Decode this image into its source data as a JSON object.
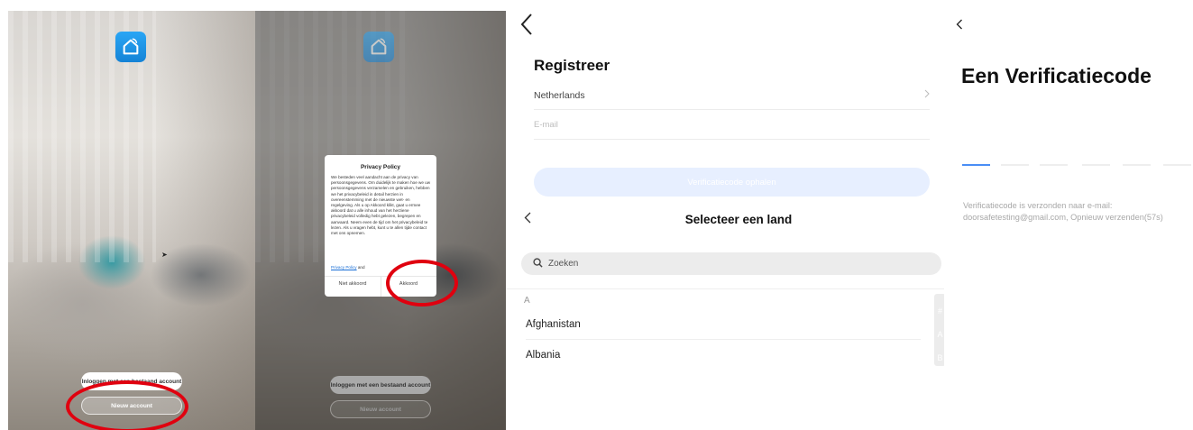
{
  "panel1": {
    "login_button": "Inloggen met een bestaand account",
    "new_account_button": "Nieuw account"
  },
  "panel2": {
    "dialog": {
      "title": "Privacy Policy",
      "body": "We besteden veel aandacht aan de privacy van persoonsgegevens. Om duidelijk te maken hoe we uw persoonsgegevens verzamelen en gebruiken, hebben we het privacybeleid in detail herzien in overeenstemming met de nieuwste wet- en regelgeving. Als u op Akkoord klikt, gaat u ermee akkoord dat u alle inhoud van het herziene privacybeleid volledig hebt gelezen, begrepen en aanvaard. Neem even de tijd om het privacybeleid te lezen. Als u vragen hebt, kunt u te allen tijde contact met ons opnemen.",
      "link_privacy": "Privacy Policy",
      "link_and": "and",
      "decline": "Niet akkoord",
      "accept": "Akkoord"
    },
    "login_button": "Inloggen met een bestaand account",
    "new_account_button": "Nieuw account"
  },
  "panel3": {
    "title": "Registreer",
    "country_value": "Netherlands",
    "email_placeholder": "E-mail",
    "verify_button": "Verificatiecode ophalen",
    "select_title": "Selecteer een land",
    "search_placeholder": "Zoeken",
    "section_letter": "A",
    "countries": [
      "Afghanistan",
      "Albania"
    ],
    "index_letters": [
      "#",
      "A",
      "B"
    ]
  },
  "panel4": {
    "title": "Een Verificatiecode",
    "message_line1": "Verificatiecode is verzonden naar e-mail:",
    "message_line2": "doorsafetesting@gmail.com, Opnieuw verzenden(57s)"
  },
  "colors": {
    "accent": "#4a8ef5",
    "highlight_ring": "#e0000f",
    "app_icon": "#1a90e8",
    "verify_button_disabled": "#e7efff"
  },
  "icons": {
    "app": "smart-home-icon",
    "back": "chevron-left-icon",
    "forward": "chevron-right-icon",
    "search": "search-icon"
  }
}
